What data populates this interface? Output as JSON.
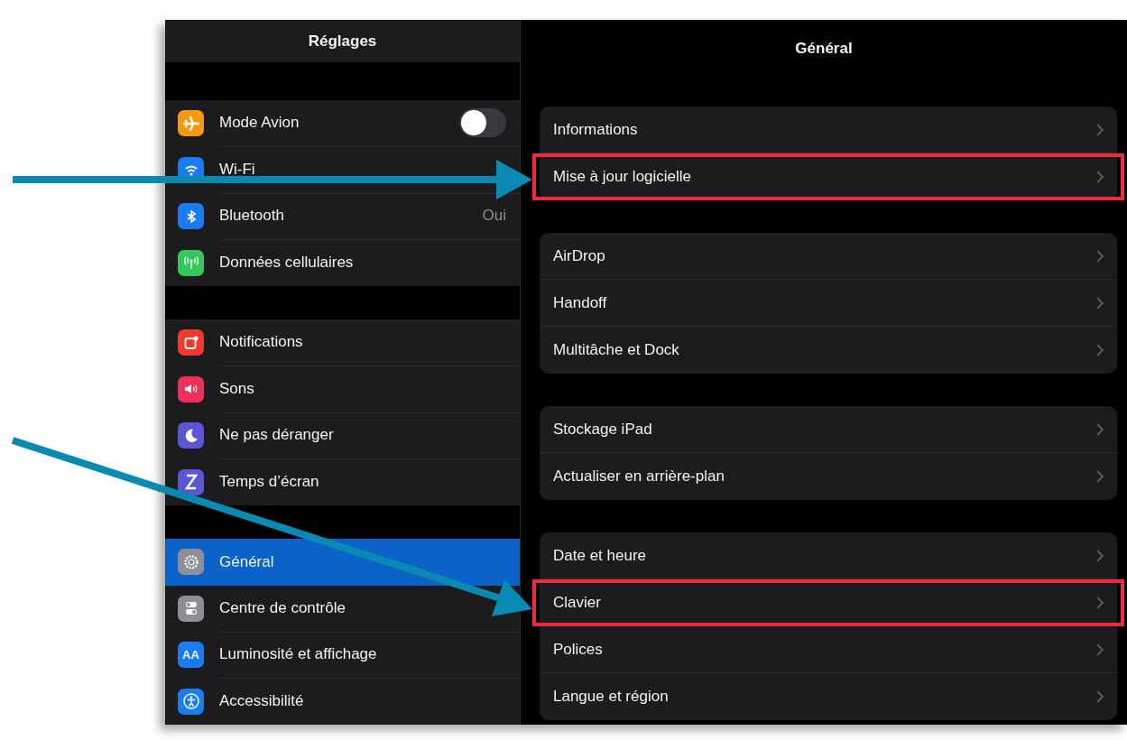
{
  "sidebar": {
    "title": "Réglages",
    "groups": [
      [
        {
          "label": "Mode Avion",
          "color": "#f59a0c",
          "kind": "toggle",
          "on": false,
          "selected": false
        },
        {
          "label": "Wi-Fi",
          "color": "#1a7cf5",
          "kind": "plain",
          "selected": false
        },
        {
          "label": "Bluetooth",
          "color": "#1a7cf5",
          "kind": "value",
          "value": "Oui",
          "selected": false
        },
        {
          "label": "Données cellulaires",
          "color": "#34c759",
          "kind": "plain",
          "selected": false
        }
      ],
      [
        {
          "label": "Notifications",
          "color": "#f0392f",
          "kind": "plain",
          "selected": false
        },
        {
          "label": "Sons",
          "color": "#f0305a",
          "kind": "plain",
          "selected": false
        },
        {
          "label": "Ne pas déranger",
          "color": "#5a56d6",
          "kind": "plain",
          "selected": false
        },
        {
          "label": "Temps d’écran",
          "color": "#5a56d6",
          "kind": "plain",
          "selected": false
        }
      ],
      [
        {
          "label": "Général",
          "color": "#8e8e93",
          "kind": "plain",
          "selected": true
        },
        {
          "label": "Centre de contrôle",
          "color": "#8e8e93",
          "kind": "plain",
          "selected": false
        },
        {
          "label": "Luminosité et affichage",
          "color": "#1a7cf5",
          "kind": "plain",
          "selected": false,
          "glyph": "AA"
        },
        {
          "label": "Accessibilité",
          "color": "#1a7cf5",
          "kind": "plain",
          "selected": false
        }
      ]
    ]
  },
  "detail": {
    "title": "Général",
    "groups": [
      [
        {
          "label": "Informations",
          "highlighted": false
        },
        {
          "label": "Mise à jour logicielle",
          "highlighted": true
        }
      ],
      [
        {
          "label": "AirDrop",
          "highlighted": false
        },
        {
          "label": "Handoff",
          "highlighted": false
        },
        {
          "label": "Multitâche et Dock",
          "highlighted": false
        }
      ],
      [
        {
          "label": "Stockage iPad",
          "highlighted": false
        },
        {
          "label": "Actualiser en arrière-plan",
          "highlighted": false
        }
      ],
      [
        {
          "label": "Date et heure",
          "highlighted": false
        },
        {
          "label": "Clavier",
          "highlighted": true
        },
        {
          "label": "Polices",
          "highlighted": false
        },
        {
          "label": "Langue et région",
          "highlighted": false
        }
      ]
    ]
  }
}
